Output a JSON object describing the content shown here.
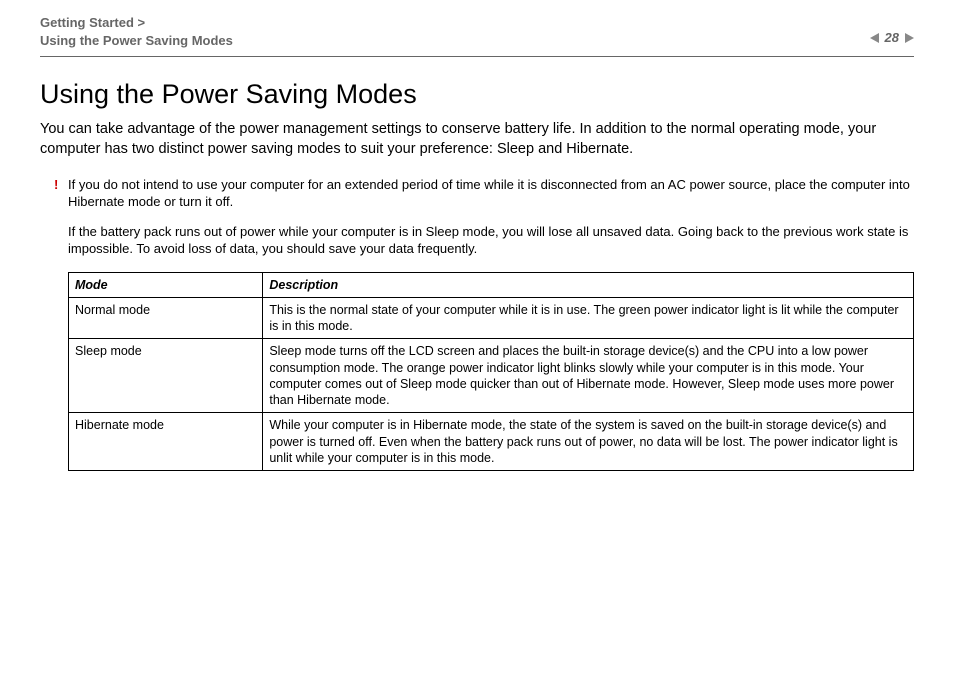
{
  "header": {
    "breadcrumb_line1": "Getting Started >",
    "breadcrumb_line2": "Using the Power Saving Modes",
    "page_number": "28"
  },
  "title": "Using the Power Saving Modes",
  "intro": "You can take advantage of the power management settings to conserve battery life. In addition to the normal operating mode, your computer has two distinct power saving modes to suit your preference: Sleep and Hibernate.",
  "note_bang": "!",
  "note_text": "If you do not intend to use your computer for an extended period of time while it is disconnected from an AC power source, place the computer into Hibernate mode or turn it off.",
  "warn_text": "If the battery pack runs out of power while your computer is in Sleep mode, you will lose all unsaved data. Going back to the previous work state is impossible. To avoid loss of data, you should save your data frequently.",
  "table": {
    "headers": {
      "mode": "Mode",
      "description": "Description"
    },
    "rows": [
      {
        "mode": "Normal mode",
        "description": "This is the normal state of your computer while it is in use. The green power indicator light is lit while the computer is in this mode."
      },
      {
        "mode": "Sleep mode",
        "description": "Sleep mode turns off the LCD screen and places the built-in storage device(s) and the CPU into a low power consumption mode. The orange power indicator light blinks slowly while your computer is in this mode. Your computer comes out of Sleep mode quicker than out of Hibernate mode. However, Sleep mode uses more power than Hibernate mode."
      },
      {
        "mode": "Hibernate mode",
        "description": "While your computer is in Hibernate mode, the state of the system is saved on the built-in storage device(s) and power is turned off. Even when the battery pack runs out of power, no data will be lost. The power indicator light is unlit while your computer is in this mode."
      }
    ]
  }
}
